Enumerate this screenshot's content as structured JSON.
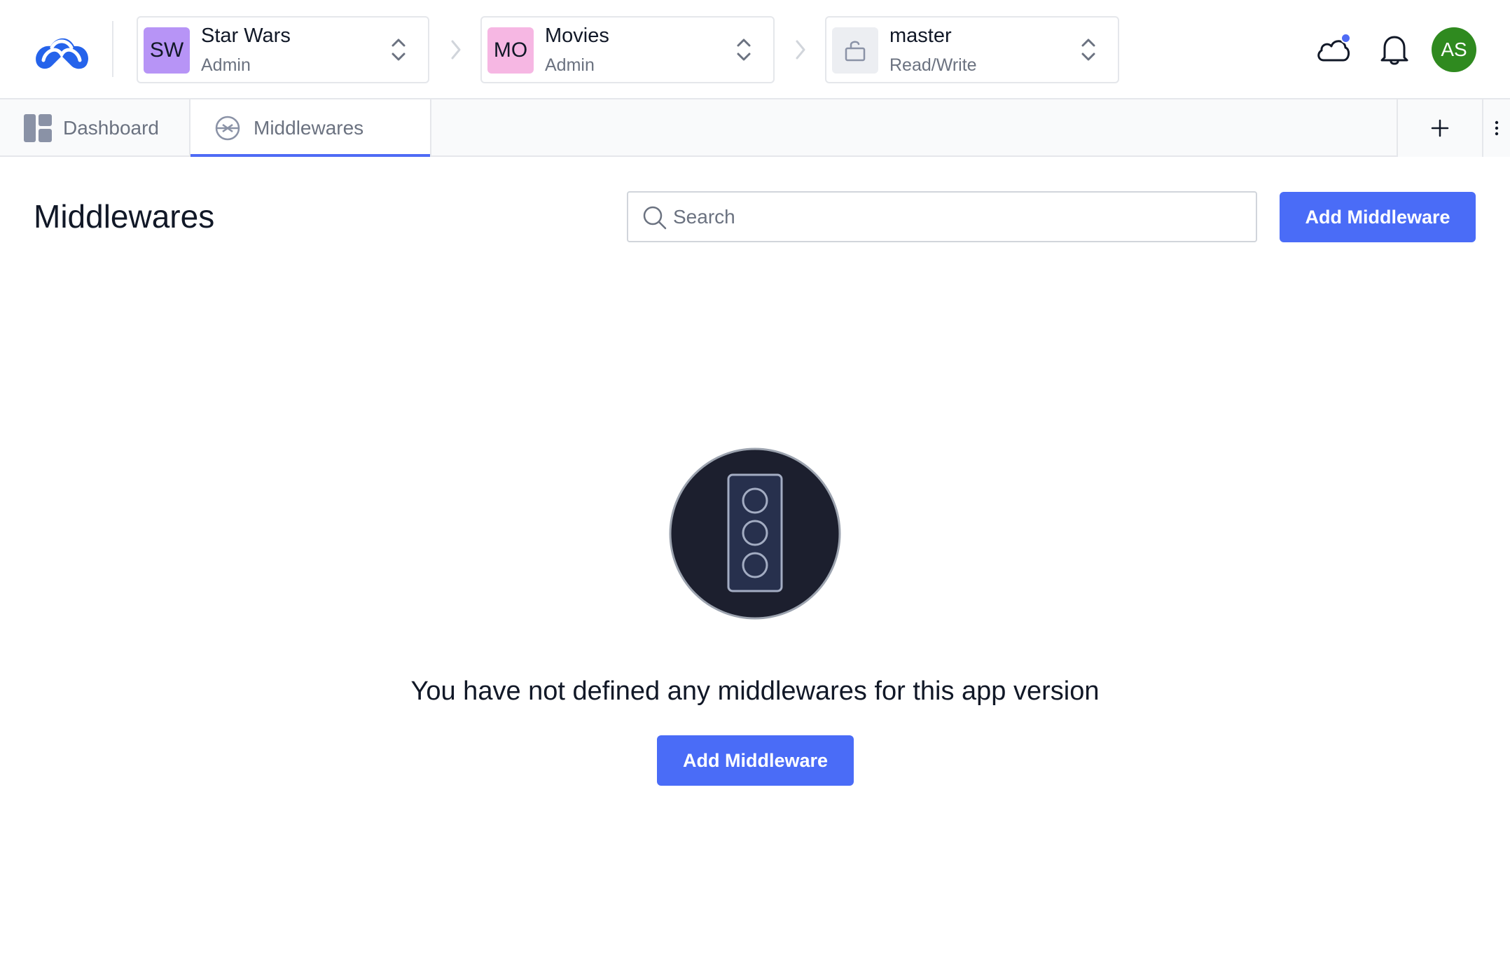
{
  "topbar": {
    "logo_icon": "bridge-logo-icon",
    "contexts": [
      {
        "badge": "SW",
        "badge_color": "#b794f6",
        "title": "Star Wars",
        "subtitle": "Admin"
      },
      {
        "badge": "MO",
        "badge_color": "#f6b7e3",
        "title": "Movies",
        "subtitle": "Admin"
      },
      {
        "badge_icon": "unlock-icon",
        "badge_color": "#eceef2",
        "title": "master",
        "subtitle": "Read/Write"
      }
    ],
    "icons": [
      "cloud-icon",
      "bell-icon"
    ],
    "avatar": "AS",
    "avatar_color": "#2f8a1f"
  },
  "tabs": [
    {
      "label": "Dashboard",
      "icon": "dashboard-icon",
      "active": false
    },
    {
      "label": "Middlewares",
      "icon": "middleware-icon",
      "active": true
    }
  ],
  "tabbar_actions": [
    "plus-icon",
    "more-vertical-icon"
  ],
  "main": {
    "title": "Middlewares",
    "search_placeholder": "Search",
    "search_value": "",
    "add_button_label": "Add Middleware",
    "empty_state": {
      "icon": "traffic-light-icon",
      "message": "You have not defined any middlewares for this app version",
      "button_label": "Add Middleware"
    }
  },
  "colors": {
    "accent": "#4a6cf7",
    "tab_active_underline": "#4f6bf5",
    "empty_icon_bg": "#1c1f2e"
  }
}
